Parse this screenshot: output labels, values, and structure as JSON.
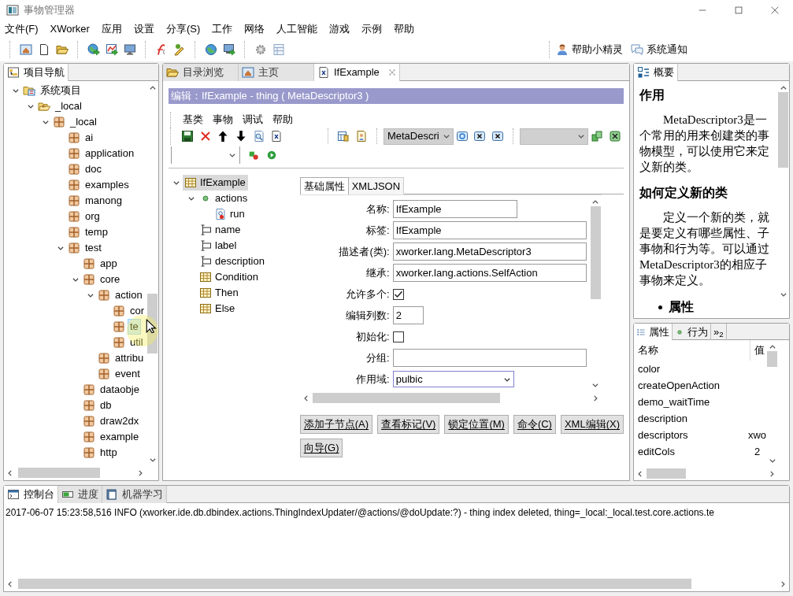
{
  "window": {
    "title": "事物管理器"
  },
  "menu": [
    "文件(F)",
    "XWorker",
    "应用",
    "设置",
    "分享(S)",
    "工作",
    "网络",
    "人工智能",
    "游戏",
    "示例",
    "帮助"
  ],
  "toolbar_links": [
    "帮助小精灵",
    "系统通知"
  ],
  "navigator": {
    "tab": "项目导航",
    "tree": [
      {
        "label": "系统项目",
        "kind": "project",
        "expanded": true,
        "selected": false,
        "children": [
          {
            "label": "_local",
            "kind": "folder",
            "expanded": true,
            "selected": false,
            "children": [
              {
                "label": "_local",
                "kind": "package",
                "expanded": true,
                "selected": false,
                "children": [
                  {
                    "label": "ai",
                    "kind": "package",
                    "selected": false
                  },
                  {
                    "label": "application",
                    "kind": "package",
                    "selected": false
                  },
                  {
                    "label": "doc",
                    "kind": "package",
                    "selected": false
                  },
                  {
                    "label": "examples",
                    "kind": "package",
                    "selected": false
                  },
                  {
                    "label": "manong",
                    "kind": "package",
                    "selected": false
                  },
                  {
                    "label": "org",
                    "kind": "package",
                    "selected": false
                  },
                  {
                    "label": "temp",
                    "kind": "package",
                    "selected": false
                  },
                  {
                    "label": "test",
                    "kind": "package",
                    "expanded": true,
                    "selected": false,
                    "children": [
                      {
                        "label": "app",
                        "kind": "package",
                        "selected": false
                      },
                      {
                        "label": "core",
                        "kind": "package",
                        "expanded": true,
                        "selected": false,
                        "children": [
                          {
                            "label": "action",
                            "kind": "package",
                            "expanded": true,
                            "selected": false,
                            "children": [
                              {
                                "label": "cor",
                                "kind": "package",
                                "selected": false
                              },
                              {
                                "label": "te",
                                "kind": "package",
                                "selected": true
                              },
                              {
                                "label": "util",
                                "kind": "package",
                                "selected": false
                              }
                            ]
                          },
                          {
                            "label": "attribu",
                            "kind": "package",
                            "selected": false
                          },
                          {
                            "label": "event",
                            "kind": "package",
                            "selected": false
                          }
                        ]
                      },
                      {
                        "label": "dataobje",
                        "kind": "package",
                        "selected": false
                      },
                      {
                        "label": "db",
                        "kind": "package",
                        "selected": false
                      },
                      {
                        "label": "draw2dx",
                        "kind": "package",
                        "selected": false
                      },
                      {
                        "label": "example",
                        "kind": "package",
                        "selected": false
                      },
                      {
                        "label": "http",
                        "kind": "package",
                        "selected": false
                      }
                    ]
                  }
                ]
              }
            ]
          }
        ]
      }
    ]
  },
  "editor": {
    "tabs": [
      {
        "label": "目录浏览",
        "kind": "folder",
        "selected": false
      },
      {
        "label": "主页",
        "kind": "home",
        "selected": false
      },
      {
        "label": "IfExample",
        "kind": "thing",
        "selected": true
      }
    ],
    "header": "编辑：IfExample - thing ( MetaDescriptor3 )",
    "menu": [
      "基类",
      "事物",
      "调试",
      "帮助"
    ],
    "class_select": "MetaDescri",
    "tree": [
      {
        "label": "IfExample",
        "kind": "thing",
        "expanded": true,
        "selected": true,
        "children": [
          {
            "label": "actions",
            "kind": "actions",
            "expanded": true,
            "selected": false,
            "children": [
              {
                "label": "run",
                "kind": "action",
                "selected": false
              }
            ]
          },
          {
            "label": "name",
            "kind": "attribute",
            "selected": false
          },
          {
            "label": "label",
            "kind": "attribute",
            "selected": false
          },
          {
            "label": "description",
            "kind": "attribute",
            "selected": false
          },
          {
            "label": "Condition",
            "kind": "thing",
            "selected": false
          },
          {
            "label": "Then",
            "kind": "thing",
            "selected": false
          },
          {
            "label": "Else",
            "kind": "thing",
            "selected": false
          }
        ]
      }
    ],
    "form_tabs": [
      {
        "label": "基础属性",
        "selected": true
      },
      {
        "label": "XMLJSON",
        "selected": false
      }
    ],
    "fields": [
      {
        "label": "名称:",
        "kind": "text",
        "value": "IfExample"
      },
      {
        "label": "标签:",
        "kind": "wide",
        "value": "IfExample"
      },
      {
        "label": "描述者(类):",
        "kind": "wide",
        "value": "xworker.lang.MetaDescriptor3"
      },
      {
        "label": "继承:",
        "kind": "wide",
        "value": "xworker.lang.actions.SelfAction"
      },
      {
        "label": "允许多个:",
        "kind": "checkbox",
        "checked": true
      },
      {
        "label": "编辑列数:",
        "kind": "short",
        "value": "2"
      },
      {
        "label": "初始化:",
        "kind": "checkbox",
        "checked": false
      },
      {
        "label": "分组:",
        "kind": "wide"
      },
      {
        "label": "作用域:",
        "kind": "select",
        "value": "pulbic"
      }
    ],
    "buttons": [
      [
        "添加子节点(A)",
        "查看标记(V)",
        "锁定位置(M)",
        "命令(C)",
        "XML编辑(X)"
      ],
      [
        "向导(G)"
      ]
    ]
  },
  "outline": {
    "tab": "概要",
    "blocks": [
      {
        "kind": "heading",
        "text": "作用"
      },
      {
        "kind": "paragraph",
        "text": "MetaDescriptor3是一个常用的用来创建类的事物模型，可以使用它来定义新的类。"
      },
      {
        "kind": "heading",
        "text": "如何定义新的类"
      },
      {
        "kind": "paragraph",
        "text": "定义一个新的类，就是要定义有哪些属性、子事物和行为等。可以通过MetaDescriptor3的相应子事物来定义。"
      },
      {
        "kind": "bullet",
        "text": "属性"
      }
    ]
  },
  "properties": {
    "tabs": [
      {
        "label": "属性",
        "kind": "list",
        "selected": true
      },
      {
        "label": "行为",
        "kind": "dot",
        "selected": false
      },
      {
        "label": "»$_{2}$",
        "kind": "more",
        "selected": false
      }
    ],
    "columns": [
      "名称",
      "值"
    ],
    "rows": [
      {
        "name": "color"
      },
      {
        "name": "createOpenAction"
      },
      {
        "name": "demo_waitTime"
      },
      {
        "name": "description"
      },
      {
        "name": "descriptors",
        "value": "xwo"
      },
      {
        "name": "editCols",
        "value": "2"
      }
    ]
  },
  "console": {
    "tabs": [
      {
        "label": "控制台",
        "kind": "console",
        "selected": true
      },
      {
        "label": "进度",
        "kind": "progress",
        "selected": false
      },
      {
        "label": "机器学习",
        "kind": "book",
        "selected": false
      }
    ],
    "lines": [
      "2017-06-07 15:23:58,516  INFO (xworker.ide.db.dbindex.actions.ThingIndexUpdater/@actions/@doUpdate:?) - thing index deleted, thing=_local:_local.test.core.actions.te"
    ]
  }
}
